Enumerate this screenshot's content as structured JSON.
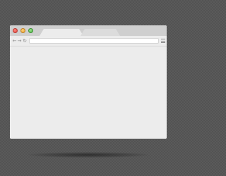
{
  "window": {
    "controls": [
      "close",
      "minimize",
      "maximize"
    ],
    "control_colors": {
      "close": "#e0413a",
      "minimize": "#e9a02c",
      "maximize": "#4fb746"
    }
  },
  "tabs": [
    {
      "label": "",
      "active": true
    },
    {
      "label": "",
      "active": false
    }
  ],
  "toolbar": {
    "back_icon": "arrow-left-icon",
    "back_glyph": "←",
    "forward_icon": "arrow-right-icon",
    "forward_glyph": "→",
    "reload_icon": "reload-icon",
    "reload_glyph": "↻",
    "address_value": "",
    "menu_icon": "hamburger-menu-icon"
  },
  "content": {
    "text": ""
  },
  "colors": {
    "background": "#5a5a5a",
    "titlebar": "#cfcfcf",
    "window": "#ececec"
  }
}
